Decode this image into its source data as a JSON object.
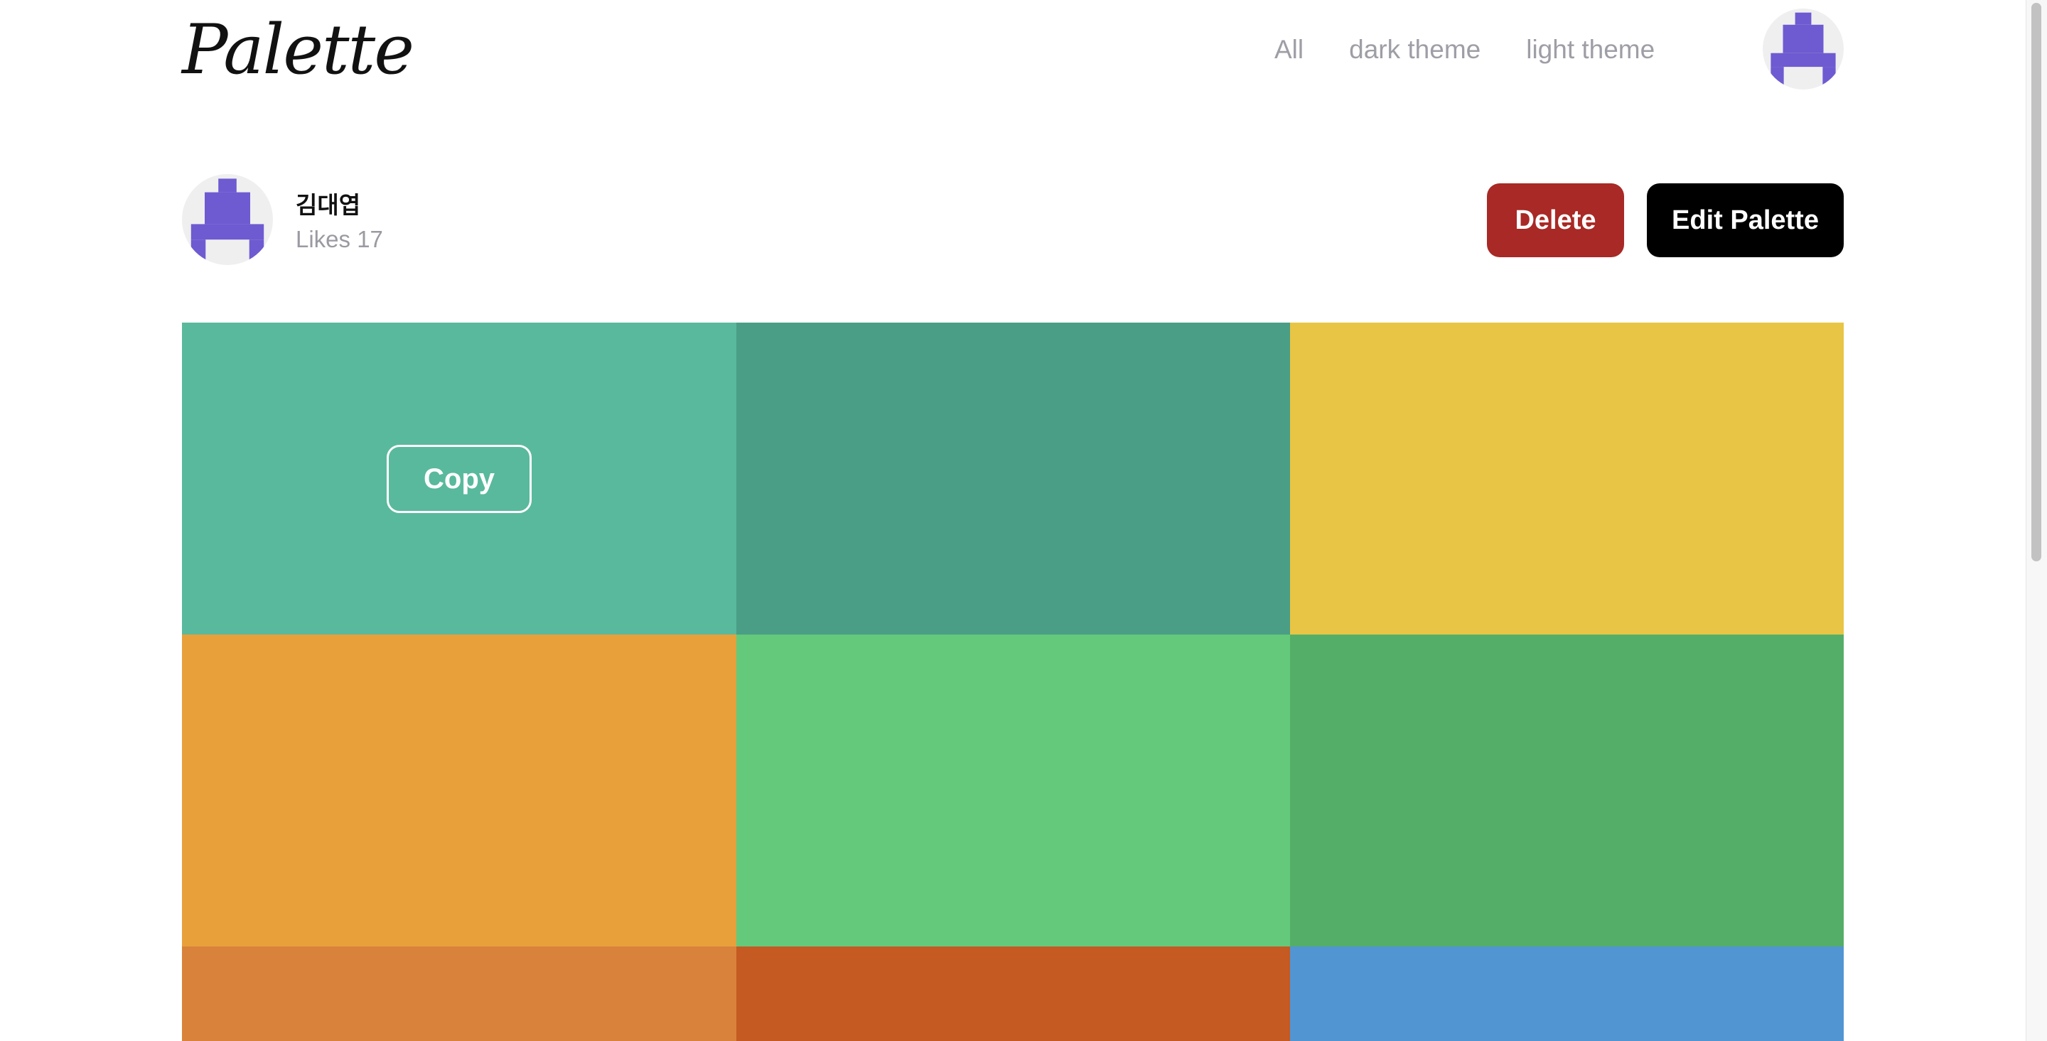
{
  "header": {
    "logo": "Palette",
    "nav": [
      "All",
      "dark theme",
      "light theme"
    ]
  },
  "user": {
    "name": "김대엽",
    "likes": "Likes 17"
  },
  "actions": {
    "delete_label": "Delete",
    "edit_label": "Edit Palette"
  },
  "palette": {
    "copy_label": "Copy",
    "colors": [
      "#59b99c",
      "#4a9e85",
      "#e8c544",
      "#e8a03b",
      "#64c97a",
      "#55ae68",
      "#d9823b",
      "#c55a22",
      "#5195d3"
    ]
  },
  "avatar": {
    "icon": "pixel-avatar-icon",
    "color": "#6e5bd1"
  }
}
